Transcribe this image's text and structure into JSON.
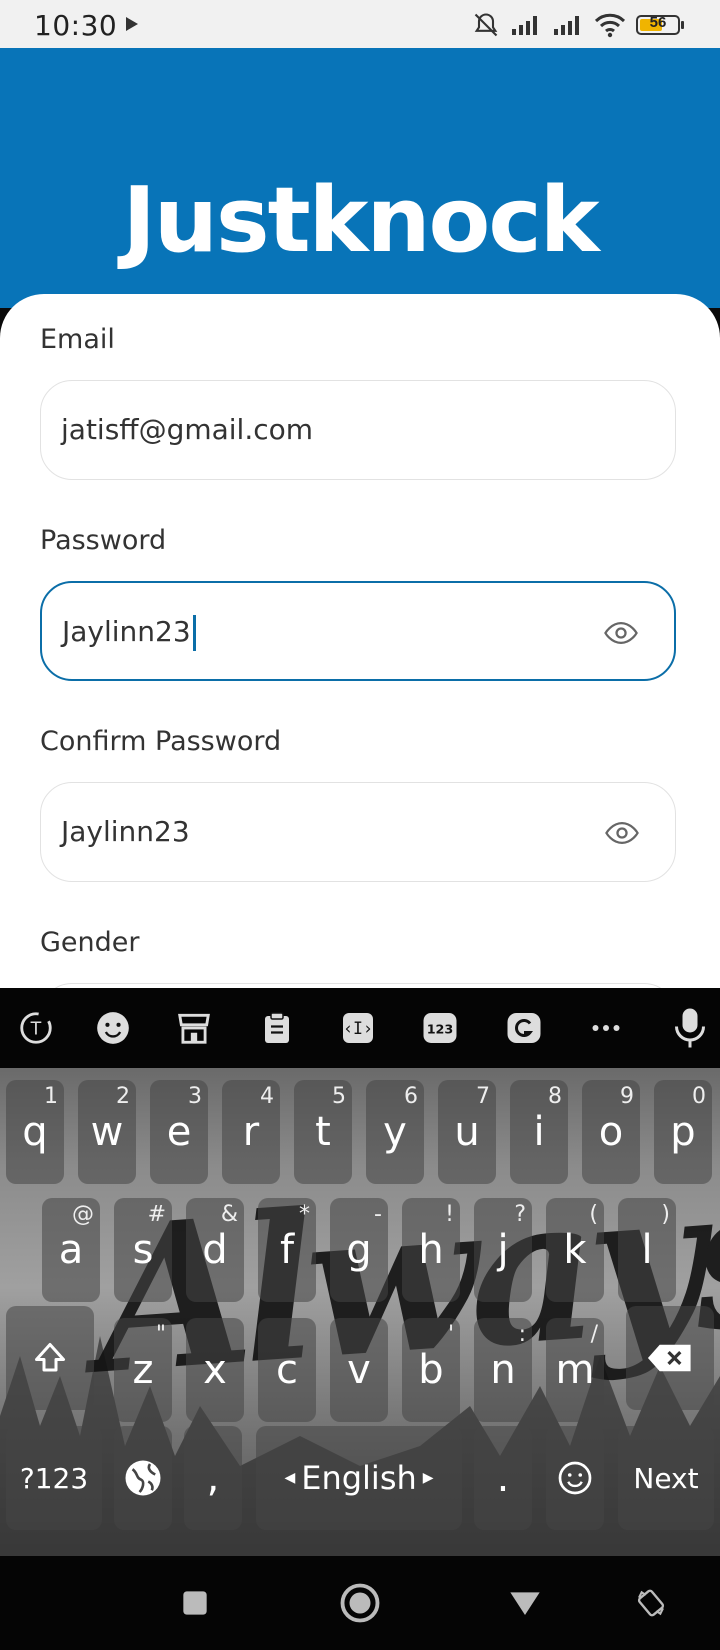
{
  "status": {
    "time": "10:30",
    "battery": "56"
  },
  "app": {
    "logo": "Justknock"
  },
  "form": {
    "email_label": "Email",
    "email_value": "jatisff@gmail.com",
    "password_label": "Password",
    "password_value": "Jaylinn23",
    "confirm_label": "Confirm Password",
    "confirm_value": "Jaylinn23",
    "gender_label": "Gender"
  },
  "keyboard": {
    "row1": [
      {
        "key": "q",
        "hint": "1"
      },
      {
        "key": "w",
        "hint": "2"
      },
      {
        "key": "e",
        "hint": "3"
      },
      {
        "key": "r",
        "hint": "4"
      },
      {
        "key": "t",
        "hint": "5"
      },
      {
        "key": "y",
        "hint": "6"
      },
      {
        "key": "u",
        "hint": "7"
      },
      {
        "key": "i",
        "hint": "8"
      },
      {
        "key": "o",
        "hint": "9"
      },
      {
        "key": "p",
        "hint": "0"
      }
    ],
    "row2": [
      {
        "key": "a",
        "hint": "@"
      },
      {
        "key": "s",
        "hint": "#"
      },
      {
        "key": "d",
        "hint": "&"
      },
      {
        "key": "f",
        "hint": "*"
      },
      {
        "key": "g",
        "hint": "-"
      },
      {
        "key": "h",
        "hint": "!"
      },
      {
        "key": "j",
        "hint": "?"
      },
      {
        "key": "k",
        "hint": "("
      },
      {
        "key": "l",
        "hint": ")"
      }
    ],
    "row3": [
      {
        "key": "z",
        "hint": "\""
      },
      {
        "key": "x",
        "hint": ""
      },
      {
        "key": "c",
        "hint": ""
      },
      {
        "key": "v",
        "hint": ""
      },
      {
        "key": "b",
        "hint": "'"
      },
      {
        "key": "n",
        "hint": ":"
      },
      {
        "key": "m",
        "hint": "/"
      }
    ],
    "symbols_label": "?123",
    "comma_label": ",",
    "space_label": "English",
    "period_label": ".",
    "next_label": "Next",
    "toolbar_num_label": "123",
    "background_art_text": "Always."
  },
  "colors": {
    "brand": "#0874b8",
    "focus": "#0b6ea8"
  }
}
